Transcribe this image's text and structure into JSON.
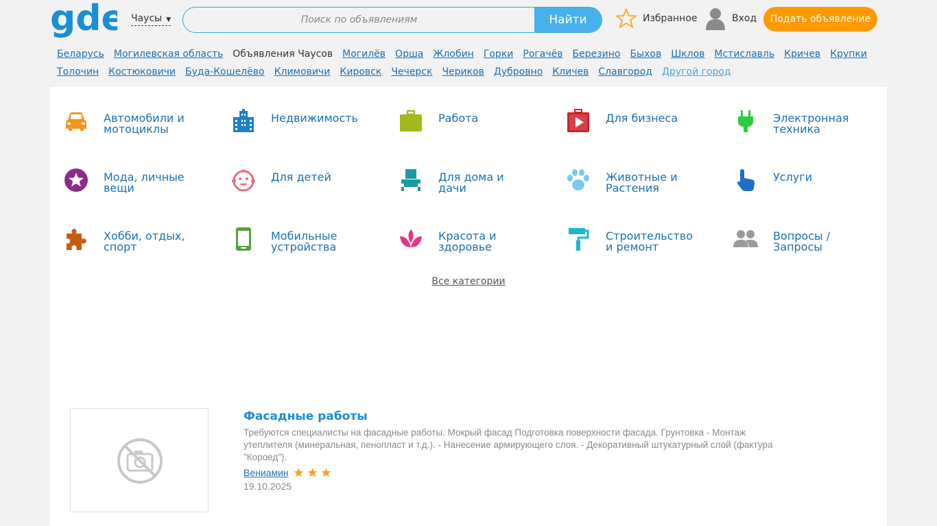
{
  "header": {
    "logo_text": "gde",
    "city": "Чаусы",
    "search_placeholder": "Поиск по объявлениям",
    "search_button": "Найти",
    "favorites": "Избранное",
    "login": "Вход",
    "post_ad": "Подать объявление"
  },
  "cities": {
    "row1": [
      "Беларусь",
      "Могилевская область"
    ],
    "current": "Объявления Чаусов",
    "row1_more": [
      "Могилёв",
      "Орша",
      "Жлобин",
      "Горки",
      "Рогачёв",
      "Березино",
      "Быхов",
      "Шклов",
      "Мстиславль",
      "Кричев",
      "Крупки"
    ],
    "row2": [
      "Толочин",
      "Костюковичи",
      "Буда-Кошелёво",
      "Климовичи",
      "Кировск",
      "Чечерск",
      "Чериков",
      "Дубровно",
      "Кличев",
      "Славгород"
    ],
    "other": "Другой город"
  },
  "categories": [
    {
      "name": "Автомобили и мотоциклы",
      "icon": "car-icon",
      "color": "#f7941d"
    },
    {
      "name": "Недвижимость",
      "icon": "buildings-icon",
      "color": "#1e7fc8"
    },
    {
      "name": "Работа",
      "icon": "briefcase-icon",
      "color": "#a3b81c"
    },
    {
      "name": "Для бизнеса",
      "icon": "business-video-icon",
      "color": "#d0202b"
    },
    {
      "name": "Электронная техника",
      "icon": "plug-icon",
      "color": "#2ecc40"
    },
    {
      "name": "Мода, личные вещи",
      "icon": "star-badge-icon",
      "color": "#8e2a8b"
    },
    {
      "name": "Для детей",
      "icon": "baby-face-icon",
      "color": "#e86f7a"
    },
    {
      "name": "Для дома и дачи",
      "icon": "armchair-icon",
      "color": "#1b9aa0"
    },
    {
      "name": "Животные и Растения",
      "icon": "paw-icon",
      "color": "#7ec8ef"
    },
    {
      "name": "Услуги",
      "icon": "hand-pointer-icon",
      "color": "#1e6fc8"
    },
    {
      "name": "Хобби, отдых, спорт",
      "icon": "puzzle-icon",
      "color": "#c75b12"
    },
    {
      "name": "Мобильные устройства",
      "icon": "mobile-phone-icon",
      "color": "#5aa03a"
    },
    {
      "name": "Красота и здоровье",
      "icon": "lotus-icon",
      "color": "#e8318a"
    },
    {
      "name": "Строительство и ремонт",
      "icon": "paint-roller-icon",
      "color": "#19b6d1"
    },
    {
      "name": "Вопросы / Запросы",
      "icon": "people-icon",
      "color": "#9a9a9a"
    }
  ],
  "all_categories": "Все категории",
  "listing": {
    "title": "Фасадные работы",
    "description": "Требуются специалисты на фасадные работы. Мокрый фасад Подготовка поверхности фасада.  Грунтовка - Монтаж утеплителя (минеральная, пенопласт и т.д.).  - Нанесение армирующего слоя.  - Декоративный штукатурный слой (фактура \"Короед\").",
    "author": "Вениамин",
    "rating": 3,
    "date": "19.10.2025"
  }
}
